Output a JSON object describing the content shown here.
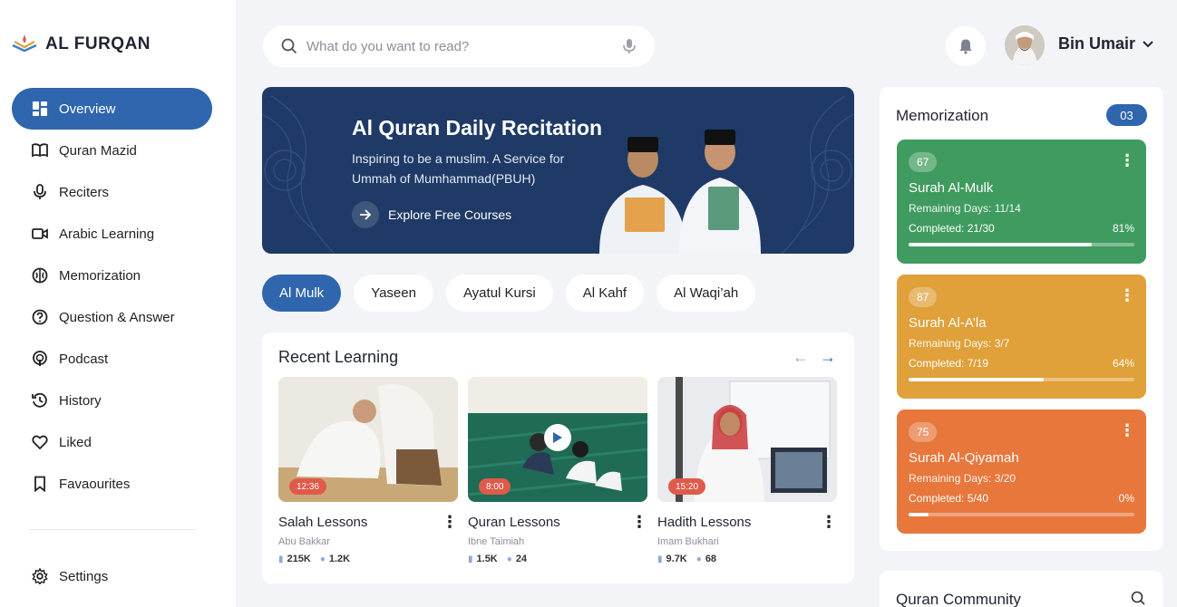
{
  "brand": {
    "name": "AL FURQAN",
    "icon": "open-quran-icon"
  },
  "nav": {
    "items": [
      {
        "label": "Overview",
        "icon": "grid-icon",
        "active": true
      },
      {
        "label": "Quran Mazid",
        "icon": "book-icon"
      },
      {
        "label": "Reciters",
        "icon": "microphone-icon"
      },
      {
        "label": "Arabic Learning",
        "icon": "video-icon"
      },
      {
        "label": "Memorization",
        "icon": "brain-icon"
      },
      {
        "label": "Question & Answer",
        "icon": "question-icon"
      },
      {
        "label": "Podcast",
        "icon": "podcast-icon"
      },
      {
        "label": "History",
        "icon": "history-icon"
      },
      {
        "label": "Liked",
        "icon": "heart-icon"
      },
      {
        "label": "Favaourites",
        "icon": "bookmark-icon"
      }
    ],
    "settings_label": "Settings"
  },
  "search": {
    "placeholder": "What do you want to read?"
  },
  "user": {
    "name": "Bin Umair"
  },
  "hero": {
    "title": "Al Quran Daily Recitation",
    "subtitle": "Inspiring to be a muslim. A Service for Ummah of Mumhammad(PBUH)",
    "cta": "Explore Free Courses"
  },
  "chips": [
    "Al Mulk",
    "Yaseen",
    "Ayatul Kursi",
    "Al Kahf",
    "Al Waqi’ah"
  ],
  "recent": {
    "title": "Recent Learning",
    "cards": [
      {
        "title": "Salah Lessons",
        "author": "Abu Bakkar",
        "duration": "12:36",
        "likes": "215K",
        "comments": "1.2K"
      },
      {
        "title": "Quran Lessons",
        "author": "Ibne Taimiah",
        "duration": "8:00",
        "likes": "1.5K",
        "comments": "24"
      },
      {
        "title": "Hadith Lessons",
        "author": "Imam Bukhari",
        "duration": "15:20",
        "likes": "9.7K",
        "comments": "68"
      }
    ]
  },
  "memorization": {
    "title": "Memorization",
    "count": "03",
    "cards": [
      {
        "badge": "67",
        "name": "Surah Al-Mulk",
        "days": "Remaining Days: 11/14",
        "completed": "Completed: 21/30",
        "percent": "81%",
        "progress": 0.81,
        "color": "#3f9b5f"
      },
      {
        "badge": "87",
        "name": "Surah Al-A’la",
        "days": "Remaining Days: 3/7",
        "completed": "Completed: 7/19",
        "percent": "64%",
        "progress": 0.6,
        "color": "#e0a03a"
      },
      {
        "badge": "75",
        "name": "Surah Al-Qiyamah",
        "days": "Remaining Days: 3/20",
        "completed": "Completed: 5/40",
        "percent": "0%",
        "progress": 0.09,
        "color": "#e8773c"
      }
    ]
  },
  "community": {
    "title": "Quran Community"
  },
  "colors": {
    "primary": "#2f66ad",
    "hero_bg": "#1f3a66",
    "duration_badge": "#e05a4a"
  }
}
